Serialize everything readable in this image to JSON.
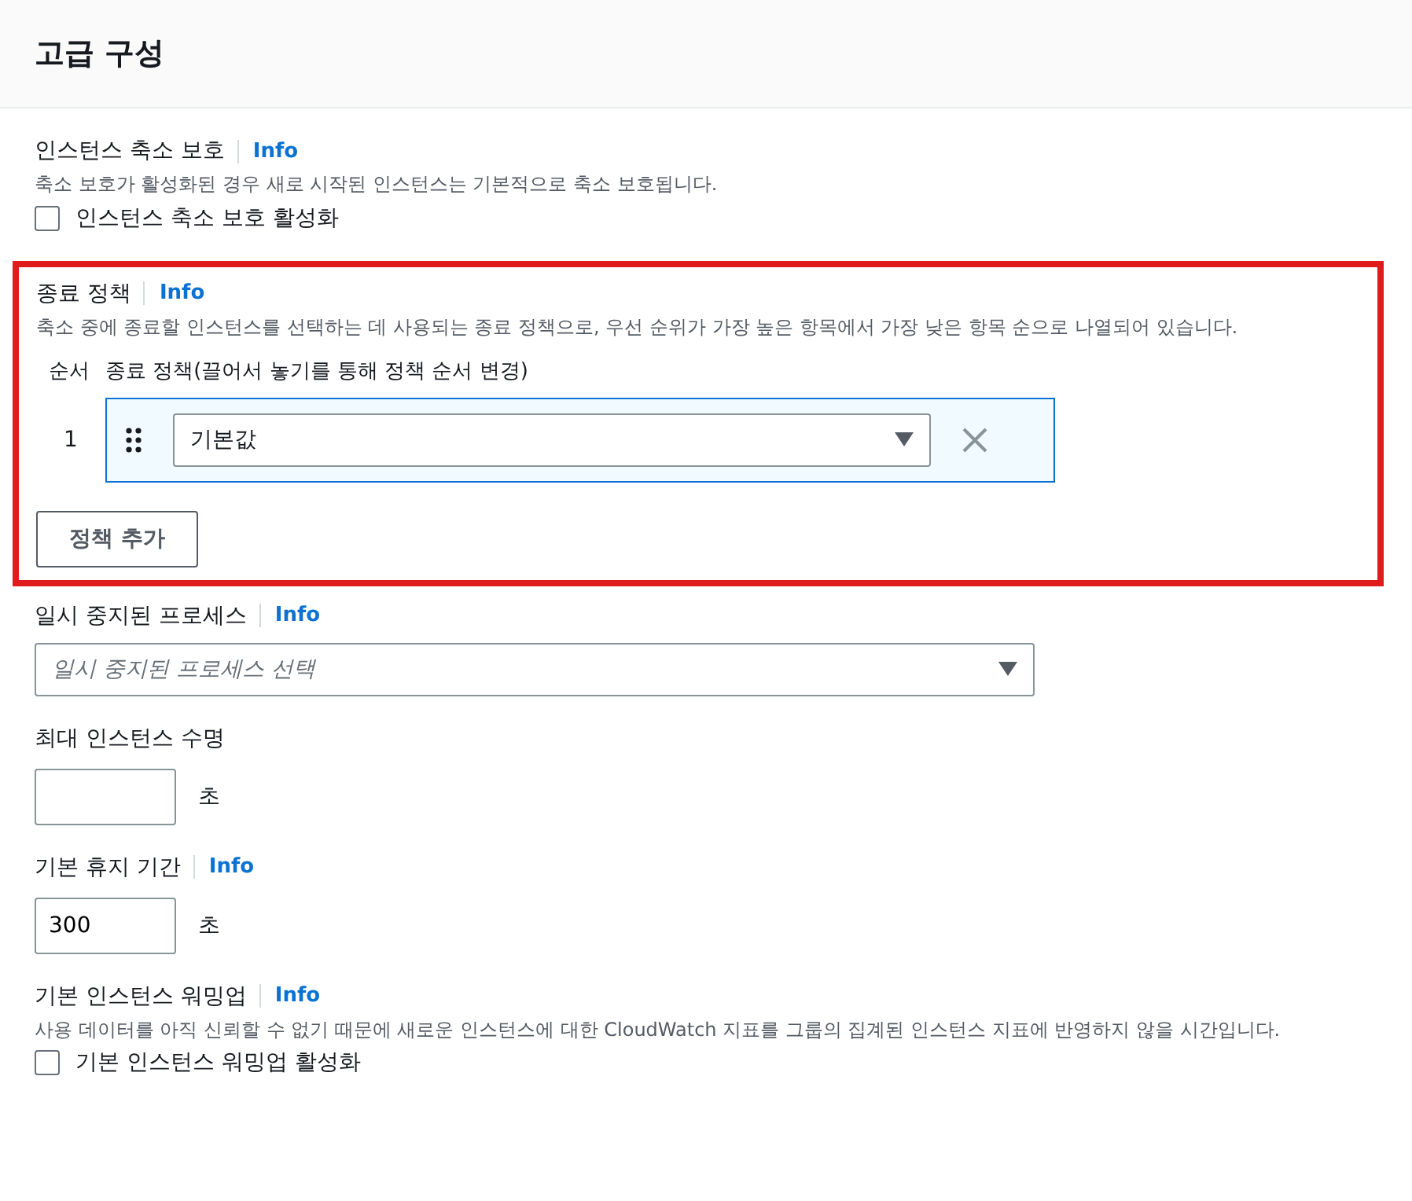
{
  "header": {
    "title": "고급 구성"
  },
  "sections": [
    {
      "kind": "checkbox",
      "label": "인스턴스 축소 보호",
      "info": "Info",
      "description": "축소 보호가 활성화된 경우 새로 시작된 인스턴스는 기본적으로 축소 보호됩니다.",
      "checkbox": {
        "label": "인스턴스 축소 보호 활성화",
        "checked": false
      }
    },
    {
      "kind": "policy",
      "highlighted": true,
      "label": "종료 정책",
      "info": "Info",
      "description": "축소 중에 종료할 인스턴스를 선택하는 데 사용되는 종료 정책으로, 우선 순위가 가장 높은 항목에서 가장 낮은 항목 순으로 나열되어 있습니다.",
      "order_header": "순서",
      "policy_header": "종료 정책(끌어서 놓기를 통해 정책 순서 변경)",
      "rows": [
        {
          "order": "1",
          "value": "기본값"
        }
      ],
      "add_button": "정책 추가"
    },
    {
      "kind": "select",
      "label": "일시 중지된 프로세스",
      "info": "Info",
      "placeholder": "일시 중지된 프로세스 선택"
    },
    {
      "kind": "number",
      "label": "최대 인스턴스 수명",
      "unit": "초"
    },
    {
      "kind": "number",
      "label": "기본 휴지 기간",
      "info": "Info",
      "value": "300",
      "unit": "초"
    },
    {
      "kind": "checkbox",
      "label": "기본 인스턴스 워밍업",
      "info": "Info",
      "description": "사용 데이터를 아직 신뢰할 수 없기 때문에 새로운 인스턴스에 대한 CloudWatch 지표를 그룹의 집계된 인스턴스 지표에 반영하지 않을 시간입니다.",
      "checkbox": {
        "label": "기본 인스턴스 워밍업 활성화",
        "checked": false
      }
    }
  ]
}
